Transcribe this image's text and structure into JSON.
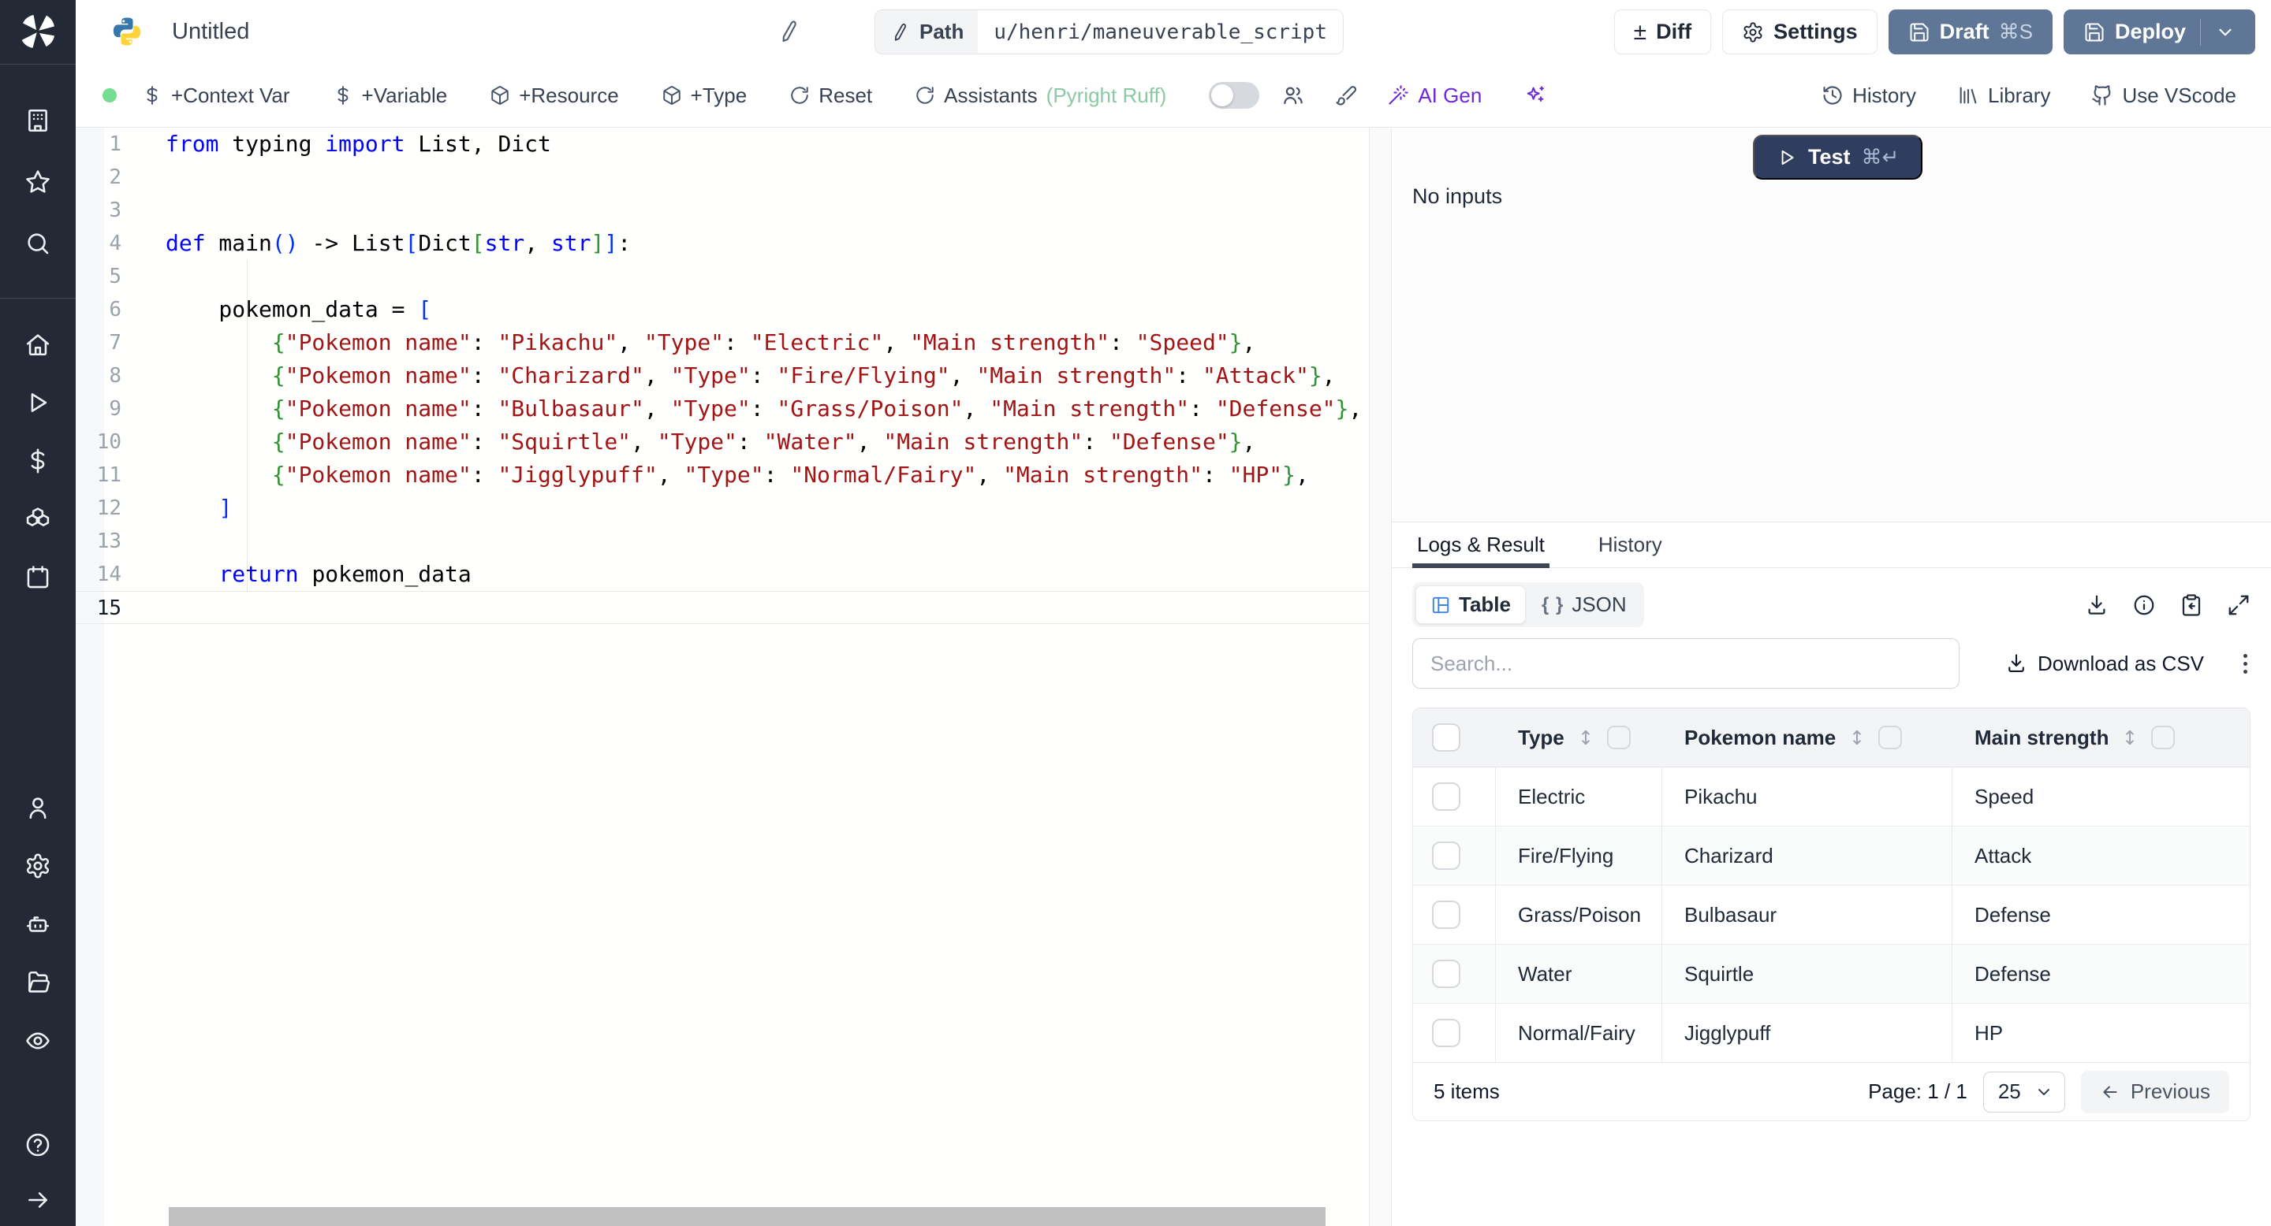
{
  "topbar": {
    "title": "Untitled",
    "path_label": "Path",
    "path_value": "u/henri/maneuverable_script",
    "diff_label": "Diff",
    "settings_label": "Settings",
    "draft_label": "Draft",
    "draft_shortcut": "⌘S",
    "deploy_label": "Deploy"
  },
  "toolbar": {
    "context_var": "+Context Var",
    "variable": "+Variable",
    "resource": "+Resource",
    "type": "+Type",
    "reset": "Reset",
    "assistants": "Assistants",
    "assistants_detail": "(Pyright Ruff)",
    "ai_gen": "AI Gen",
    "history": "History",
    "library": "Library",
    "use_vscode": "Use VScode"
  },
  "sidebar": {
    "groups": [
      [
        "building",
        "star",
        "search"
      ],
      [
        "home",
        "play",
        "dollar",
        "boxes",
        "calendar"
      ],
      [
        "user",
        "gear",
        "bot",
        "folder",
        "eye"
      ],
      [
        "help",
        "arrow-right"
      ]
    ]
  },
  "editor": {
    "active_line": 15,
    "lines": [
      {
        "n": 1,
        "t": [
          [
            "k",
            "from"
          ],
          [
            "p",
            " typing "
          ],
          [
            "k",
            "import"
          ],
          [
            "p",
            " List, Dict"
          ]
        ]
      },
      {
        "n": 2,
        "t": []
      },
      {
        "n": 3,
        "t": []
      },
      {
        "n": 4,
        "t": [
          [
            "k",
            "def"
          ],
          [
            "p",
            " main"
          ],
          [
            "b1",
            "()"
          ],
          [
            "p",
            " -> List"
          ],
          [
            "b1",
            "["
          ],
          [
            "p",
            "Dict"
          ],
          [
            "b2",
            "["
          ],
          [
            "k",
            "str"
          ],
          [
            "p",
            ", "
          ],
          [
            "k",
            "str"
          ],
          [
            "b2",
            "]"
          ],
          [
            "b1",
            "]"
          ],
          [
            "p",
            ":"
          ]
        ]
      },
      {
        "n": 5,
        "t": []
      },
      {
        "n": 6,
        "t": [
          [
            "p",
            "    pokemon_data = "
          ],
          [
            "b1",
            "["
          ]
        ]
      },
      {
        "n": 7,
        "t": [
          [
            "p",
            "        "
          ],
          [
            "b2",
            "{"
          ],
          [
            "s",
            "\"Pokemon name\""
          ],
          [
            "p",
            ": "
          ],
          [
            "s",
            "\"Pikachu\""
          ],
          [
            "p",
            ", "
          ],
          [
            "s",
            "\"Type\""
          ],
          [
            "p",
            ": "
          ],
          [
            "s",
            "\"Electric\""
          ],
          [
            "p",
            ", "
          ],
          [
            "s",
            "\"Main strength\""
          ],
          [
            "p",
            ": "
          ],
          [
            "s",
            "\"Speed\""
          ],
          [
            "b2",
            "}"
          ],
          [
            "p",
            ","
          ]
        ]
      },
      {
        "n": 8,
        "t": [
          [
            "p",
            "        "
          ],
          [
            "b2",
            "{"
          ],
          [
            "s",
            "\"Pokemon name\""
          ],
          [
            "p",
            ": "
          ],
          [
            "s",
            "\"Charizard\""
          ],
          [
            "p",
            ", "
          ],
          [
            "s",
            "\"Type\""
          ],
          [
            "p",
            ": "
          ],
          [
            "s",
            "\"Fire/Flying\""
          ],
          [
            "p",
            ", "
          ],
          [
            "s",
            "\"Main strength\""
          ],
          [
            "p",
            ": "
          ],
          [
            "s",
            "\"Attack\""
          ],
          [
            "b2",
            "}"
          ],
          [
            "p",
            ","
          ]
        ]
      },
      {
        "n": 9,
        "t": [
          [
            "p",
            "        "
          ],
          [
            "b2",
            "{"
          ],
          [
            "s",
            "\"Pokemon name\""
          ],
          [
            "p",
            ": "
          ],
          [
            "s",
            "\"Bulbasaur\""
          ],
          [
            "p",
            ", "
          ],
          [
            "s",
            "\"Type\""
          ],
          [
            "p",
            ": "
          ],
          [
            "s",
            "\"Grass/Poison\""
          ],
          [
            "p",
            ", "
          ],
          [
            "s",
            "\"Main strength\""
          ],
          [
            "p",
            ": "
          ],
          [
            "s",
            "\"Defense\""
          ],
          [
            "b2",
            "}"
          ],
          [
            "p",
            ","
          ]
        ]
      },
      {
        "n": 10,
        "t": [
          [
            "p",
            "        "
          ],
          [
            "b2",
            "{"
          ],
          [
            "s",
            "\"Pokemon name\""
          ],
          [
            "p",
            ": "
          ],
          [
            "s",
            "\"Squirtle\""
          ],
          [
            "p",
            ", "
          ],
          [
            "s",
            "\"Type\""
          ],
          [
            "p",
            ": "
          ],
          [
            "s",
            "\"Water\""
          ],
          [
            "p",
            ", "
          ],
          [
            "s",
            "\"Main strength\""
          ],
          [
            "p",
            ": "
          ],
          [
            "s",
            "\"Defense\""
          ],
          [
            "b2",
            "}"
          ],
          [
            "p",
            ","
          ]
        ]
      },
      {
        "n": 11,
        "t": [
          [
            "p",
            "        "
          ],
          [
            "b2",
            "{"
          ],
          [
            "s",
            "\"Pokemon name\""
          ],
          [
            "p",
            ": "
          ],
          [
            "s",
            "\"Jigglypuff\""
          ],
          [
            "p",
            ", "
          ],
          [
            "s",
            "\"Type\""
          ],
          [
            "p",
            ": "
          ],
          [
            "s",
            "\"Normal/Fairy\""
          ],
          [
            "p",
            ", "
          ],
          [
            "s",
            "\"Main strength\""
          ],
          [
            "p",
            ": "
          ],
          [
            "s",
            "\"HP\""
          ],
          [
            "b2",
            "}"
          ],
          [
            "p",
            ","
          ]
        ]
      },
      {
        "n": 12,
        "t": [
          [
            "p",
            "    "
          ],
          [
            "b1",
            "]"
          ]
        ]
      },
      {
        "n": 13,
        "t": []
      },
      {
        "n": 14,
        "t": [
          [
            "p",
            "    "
          ],
          [
            "k",
            "return"
          ],
          [
            "p",
            " pokemon_data"
          ]
        ]
      },
      {
        "n": 15,
        "t": []
      }
    ]
  },
  "run_panel": {
    "test_label": "Test",
    "test_shortcut": "⌘↵",
    "no_inputs": "No inputs",
    "tabs": [
      "Logs & Result",
      "History"
    ],
    "view_table": "Table",
    "view_json": "JSON",
    "braces_glyph": "{ }",
    "search_placeholder": "Search...",
    "download_csv": "Download as CSV",
    "table": {
      "columns": [
        "Type",
        "Pokemon name",
        "Main strength"
      ],
      "rows": [
        [
          "Electric",
          "Pikachu",
          "Speed"
        ],
        [
          "Fire/Flying",
          "Charizard",
          "Attack"
        ],
        [
          "Grass/Poison",
          "Bulbasaur",
          "Defense"
        ],
        [
          "Water",
          "Squirtle",
          "Defense"
        ],
        [
          "Normal/Fairy",
          "Jigglypuff",
          "HP"
        ]
      ],
      "items_label": "5 items",
      "page_label": "Page: 1 / 1",
      "page_size": "25",
      "previous_label": "Previous"
    }
  },
  "colors": {
    "sidebar_bg": "#232a36",
    "primary_button": "#5f7697",
    "test_button": "#2f3d5f",
    "accent_blue": "#3b82f6",
    "ai_purple": "#6d28d9",
    "assist_green": "#8bc9a4",
    "status_green": "#74dd8f",
    "keyword": "#0000ff",
    "string": "#a31515"
  }
}
